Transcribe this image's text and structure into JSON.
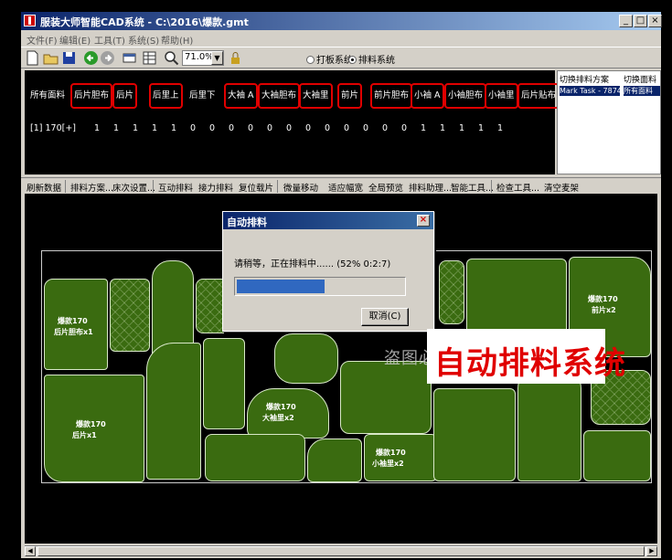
{
  "window": {
    "title": "服装大师智能CAD系统 - C:\\2016\\爆款.gmt",
    "minimize": "_",
    "maximize": "□",
    "close": "×"
  },
  "menu": [
    "文件(F)",
    "编辑(E)",
    "工具(T)",
    "系统(S)",
    "帮助(H)"
  ],
  "toolbar": {
    "zoom_value": "71.0%",
    "zoom_arrow": "▼",
    "mode_pattern": "打板系统",
    "mode_marker": "排料系统"
  },
  "fabric_table": {
    "headers": [
      "所有面料",
      "后片胆布",
      "后片",
      "后里上",
      "后里下",
      "大袖 A",
      "大袖胆布",
      "大袖里",
      "前片",
      "前片胆布",
      "小袖 A",
      "小袖胆布",
      "小袖里",
      "后片贴布"
    ],
    "row_label": "[1] 170[+]",
    "quantities": [
      "1",
      "1",
      "1",
      "1",
      "1",
      "0",
      "0",
      "0",
      "0",
      "0",
      "0",
      "0",
      "0",
      "0",
      "0",
      "0",
      "0",
      "1",
      "1",
      "1",
      "1",
      "1"
    ],
    "selected_index": 12
  },
  "side_panel": {
    "switch_scheme_label": "切换排料方案",
    "switch_fabric_label": "切换面料",
    "scheme_value": "Mark Task - 7874",
    "fabric_value": "所有面料"
  },
  "actions": [
    "刷新数据",
    "排料方案...",
    "床次设置...",
    "互动排料",
    "接力排料",
    "复位载片",
    "微量移动",
    "适应幅宽",
    "全局预览",
    "排料助理...",
    "智能工具...",
    "检查工具...",
    "清空麦架"
  ],
  "pieces": [
    {
      "line1": "爆款170",
      "line2": "后片胆布x1"
    },
    {
      "line1": "爆款170",
      "line2": "前片x2"
    },
    {
      "line1": "爆款170",
      "line2": "大袖里x2"
    },
    {
      "line1": "爆款170",
      "line2": "小袖里x2"
    },
    {
      "line1": "爆款170",
      "line2": "后片x1"
    }
  ],
  "dialog": {
    "title": "自动排料",
    "message": "请稍等，正在排料中...... (52%  0:2:7)",
    "progress_percent": 52,
    "cancel_label": "取消(C)"
  },
  "watermark": {
    "faint_text": "盗图必究  QQ:3492527052",
    "banner_text": "自动排料系统"
  },
  "colors": {
    "piece_fill": "#3a6b10",
    "progress_fill": "#3068c0",
    "highlight_frame": "#e00000"
  }
}
